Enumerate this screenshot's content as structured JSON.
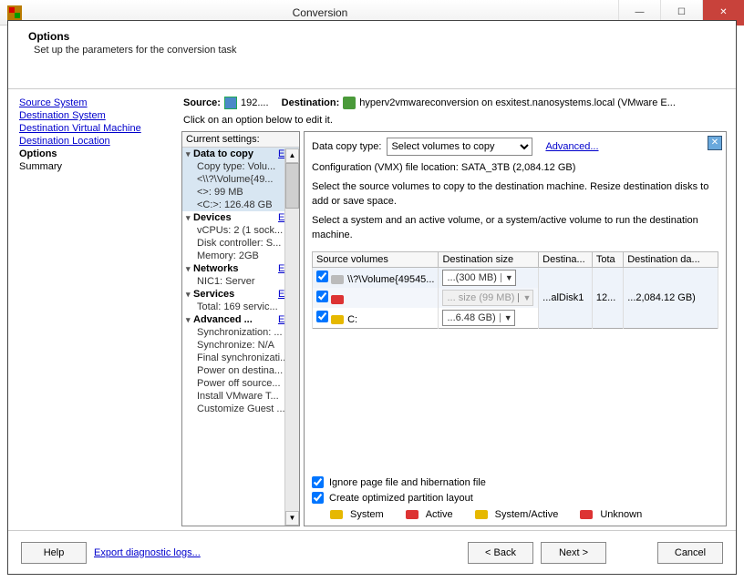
{
  "window": {
    "title": "Conversion"
  },
  "header": {
    "title": "Options",
    "subtitle": "Set up the parameters for the conversion task"
  },
  "nav": {
    "items": [
      {
        "label": "Source System",
        "link": true
      },
      {
        "label": "Destination System",
        "link": true
      },
      {
        "label": "Destination Virtual Machine",
        "link": true
      },
      {
        "label": "Destination Location",
        "link": true
      },
      {
        "label": "Options",
        "current": true
      },
      {
        "label": "Summary",
        "plain": true
      }
    ]
  },
  "summaryline": {
    "source_label": "Source:",
    "source_value": "192....",
    "dest_label": "Destination:",
    "dest_value": "hyperv2vmwareconversion on esxitest.nanosystems.local (VMware E..."
  },
  "clickline": "Click on an option below to edit it.",
  "tree": {
    "header": "Current settings:",
    "edit": "Edit",
    "groups": [
      {
        "title": "Data to copy",
        "hl": true,
        "items": [
          {
            "text": "Copy type: Volu...",
            "hl": true
          },
          {
            "text": "<\\\\?\\Volume{49...",
            "hl": true
          },
          {
            "text": "<>: 99 MB",
            "hl": true
          },
          {
            "text": "<C:>: 126.48 GB",
            "hl": true
          }
        ]
      },
      {
        "title": "Devices",
        "items": [
          {
            "text": "vCPUs: 2 (1 sock..."
          },
          {
            "text": "Disk controller: S..."
          },
          {
            "text": "Memory: 2GB"
          }
        ]
      },
      {
        "title": "Networks",
        "items": [
          {
            "text": "NIC1: Server"
          }
        ]
      },
      {
        "title": "Services",
        "items": [
          {
            "text": "Total: 169 servic..."
          }
        ]
      },
      {
        "title": "Advanced ...",
        "items": [
          {
            "text": "Synchronization: ..."
          },
          {
            "text": "Synchronize: N/A"
          },
          {
            "text": "Final synchronizati..."
          },
          {
            "text": "Power on destina..."
          },
          {
            "text": "Power off source..."
          },
          {
            "text": "Install VMware T..."
          },
          {
            "text": "Customize Guest ..."
          }
        ]
      }
    ]
  },
  "details": {
    "copytype_label": "Data copy type:",
    "copytype_value": "Select volumes to copy",
    "advanced": "Advanced...",
    "config_line": "Configuration (VMX) file location: SATA_3TB (2,084.12 GB)",
    "help1": "Select the source volumes to copy to the destination machine. Resize destination disks to add or save space.",
    "help2": "Select a system and an active volume, or a system/active volume to run the destination machine.",
    "cols": [
      "Source volumes",
      "Destination size",
      "Destina...",
      "Tota",
      "Destination da..."
    ],
    "rows": [
      {
        "name": "\\\\?\\Volume{49545...",
        "color": "gray",
        "size": "...(300 MB)",
        "disabled": false
      },
      {
        "name": "",
        "color": "red",
        "size": "... size (99 MB)",
        "disabled": true
      },
      {
        "name": "C:",
        "color": "yellow",
        "size": "...6.48 GB)",
        "disabled": false
      }
    ],
    "merged": {
      "disk": "...alDisk1",
      "total": "12...",
      "dest": "...2,084.12 GB)"
    },
    "chk1": "Ignore page file and hibernation file",
    "chk2": "Create optimized partition layout",
    "legend": [
      "System",
      "Active",
      "System/Active",
      "Unknown"
    ]
  },
  "footer": {
    "help": "Help",
    "export": "Export diagnostic logs...",
    "back": "< Back",
    "next": "Next >",
    "cancel": "Cancel"
  }
}
